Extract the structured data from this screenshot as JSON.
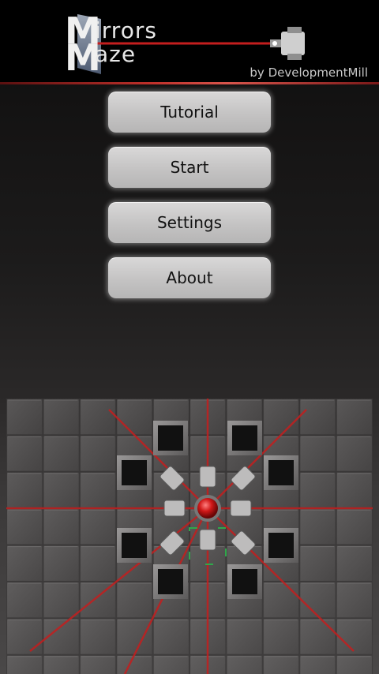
{
  "header": {
    "logo_word_1": "irrors",
    "logo_word_2": "aze",
    "logo_initial_1": "M",
    "logo_initial_2": "M",
    "byline": "by DevelopmentMill"
  },
  "menu": {
    "tutorial": "Tutorial",
    "start": "Start",
    "settings": "Settings",
    "about": "About"
  },
  "colors": {
    "laser": "#c41e1e",
    "header_line": "#c0302a",
    "button_face": "#cfcece"
  },
  "icons": {
    "logo_emitter": "laser-emitter-icon",
    "board_core": "red-core-icon",
    "board_emitters": "laser-emitter-icon",
    "board_blocks": "dark-block-icon"
  }
}
